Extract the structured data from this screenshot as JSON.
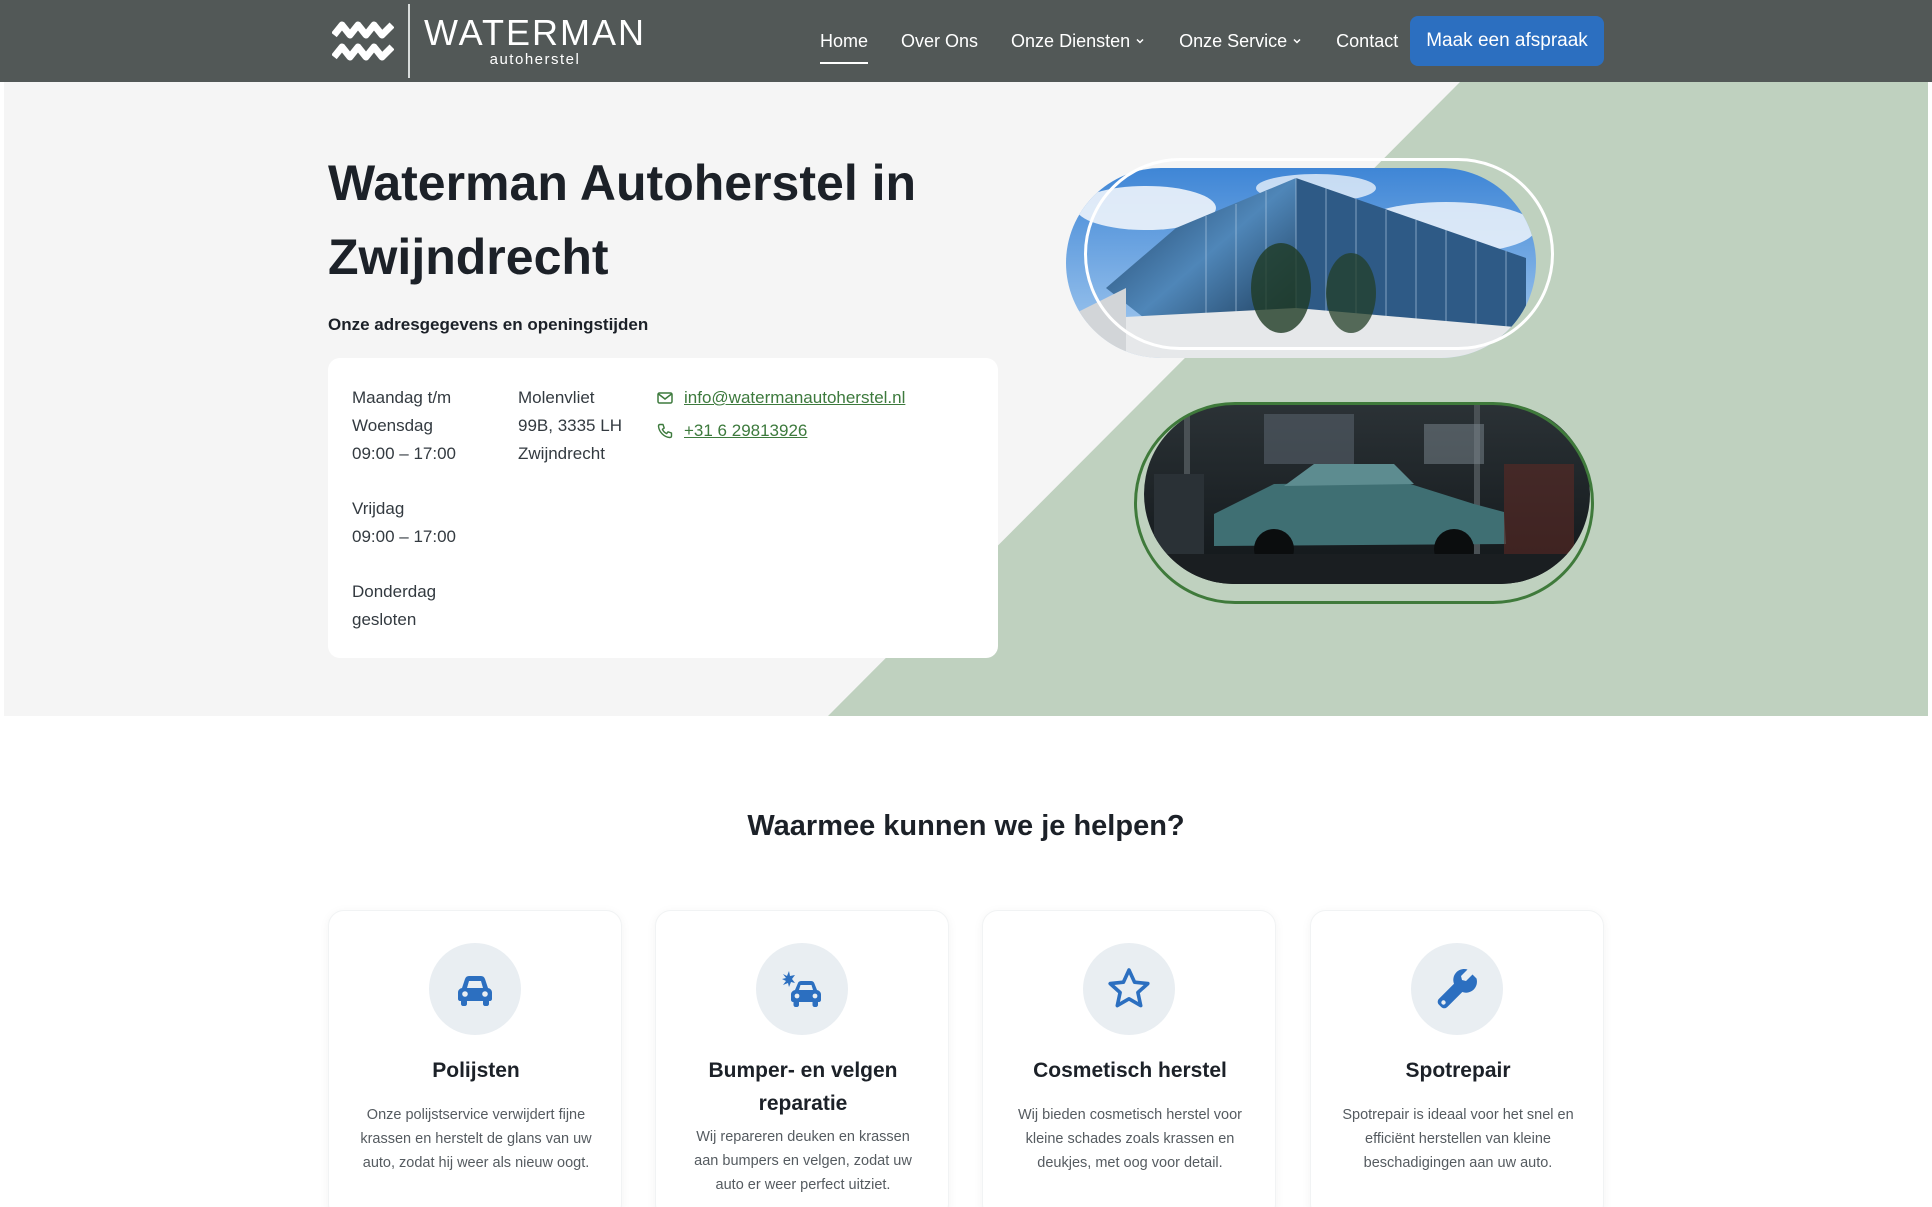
{
  "brand": {
    "name": "WATERMAN",
    "sub": "autoherstel"
  },
  "nav": {
    "items": [
      {
        "label": "Home",
        "active": true,
        "dropdown": false
      },
      {
        "label": "Over Ons",
        "active": false,
        "dropdown": false
      },
      {
        "label": "Onze Diensten",
        "active": false,
        "dropdown": true
      },
      {
        "label": "Onze Service",
        "active": false,
        "dropdown": true
      },
      {
        "label": "Contact",
        "active": false,
        "dropdown": false
      }
    ],
    "cta_label": "Maak een afspraak"
  },
  "hero": {
    "title": "Waterman Autoherstel in Zwijndrecht",
    "subtitle": "Onze adresgegevens en openingstijden",
    "hours": [
      {
        "days": "Maandag t/m Woensdag",
        "time": "09:00 – 17:00"
      },
      {
        "days": "Vrijdag",
        "time": "09:00 – 17:00"
      },
      {
        "days": "Donderdag",
        "time": "gesloten"
      }
    ],
    "address": "Molenvliet 99B, 3335 LH Zwijndrecht",
    "email": "info@watermanautoherstel.nl",
    "phone": "+31 6 29813926"
  },
  "services": {
    "title": "Waarmee kunnen we je helpen?",
    "items": [
      {
        "icon": "car-icon",
        "title": "Polijsten",
        "desc": "Onze polijstservice verwijdert fijne krassen en herstelt de glans van uw auto, zodat hij weer als nieuw oogt."
      },
      {
        "icon": "car-crash-icon",
        "title": "Bumper- en velgen reparatie",
        "desc": "Wij repareren deuken en krassen aan bumpers en velgen, zodat uw auto er weer perfect uitziet."
      },
      {
        "icon": "star-icon",
        "title": "Cosmetisch herstel",
        "desc": "Wij bieden cosmetisch herstel voor kleine schades zoals krassen en deukjes, met oog voor detail."
      },
      {
        "icon": "wrench-icon",
        "title": "Spotrepair",
        "desc": "Spotrepair is ideaal voor het snel en efficiënt herstellen van kleine beschadigingen aan uw auto."
      }
    ]
  },
  "colors": {
    "header_bg": "#525857",
    "accent_blue": "#2c6fc0",
    "hero_green": "#bfd1bf",
    "link_green": "#3d7a3d"
  }
}
